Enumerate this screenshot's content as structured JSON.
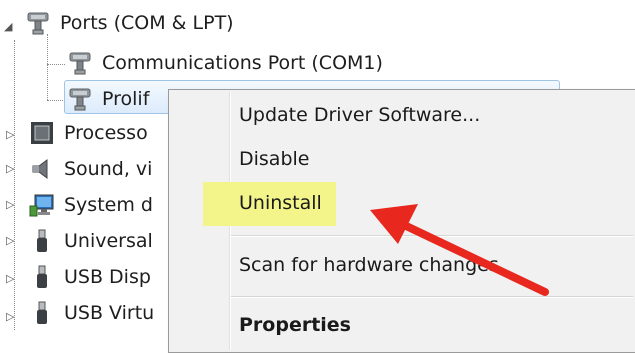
{
  "tree": {
    "ports_label": "Ports (COM & LPT)",
    "comm_port_label": "Communications Port (COM1)",
    "prolific_label": "Prolif",
    "processors_label": "Processo",
    "sound_label": "Sound, vi",
    "system_label": "System d",
    "universal_label": "Universal",
    "usb_disp_label": "USB Disp",
    "usb_virt_label": "USB Virtu"
  },
  "context_menu": {
    "update_driver": "Update Driver Software...",
    "disable": "Disable",
    "uninstall": "Uninstall",
    "scan": "Scan for hardware changes",
    "properties": "Properties"
  },
  "colors": {
    "highlight": "#f3f58a",
    "arrow": "#e8281e",
    "selection": "#dcebfb"
  },
  "icons": {
    "ports": "serial-port-icon",
    "processor": "processor-icon",
    "sound": "speaker-icon",
    "system": "computer-icon",
    "usb": "usb-plug-icon"
  }
}
